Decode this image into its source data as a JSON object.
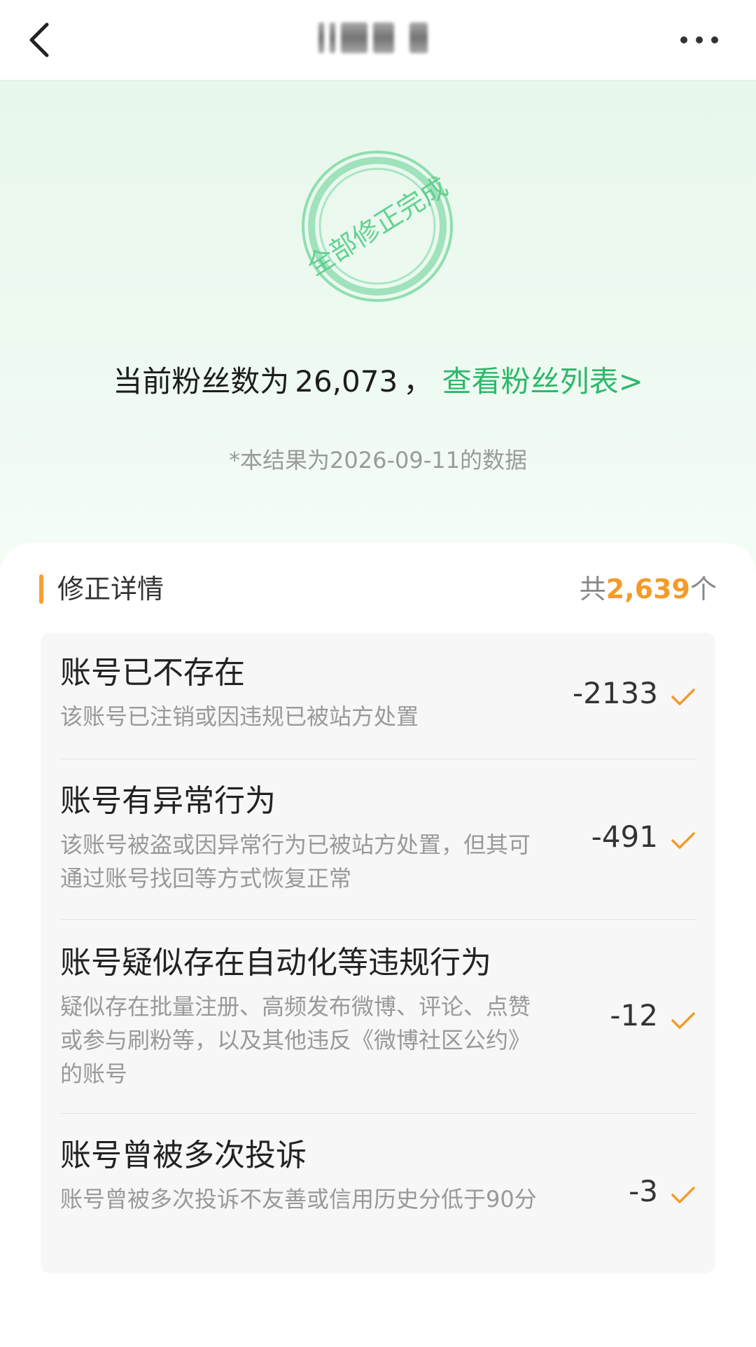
{
  "header": {
    "back_icon": "chevron-left-icon",
    "more_icon": "more-horizontal-icon"
  },
  "hero": {
    "stamp_text": "全部修正完成",
    "fans_prefix": "当前粉丝数为",
    "fans_count": "26,073",
    "fans_separator": "，",
    "fans_link": "查看粉丝列表>",
    "note": "*本结果为2026-09-11的数据"
  },
  "details": {
    "title": "修正详情",
    "total_prefix": "共",
    "total_count": "2,639",
    "total_suffix": "个",
    "items": [
      {
        "title": "账号已不存在",
        "desc": "该账号已注销或因违规已被站方处置",
        "value": "-2133"
      },
      {
        "title": "账号有异常行为",
        "desc": "该账号被盗或因异常行为已被站方处置，但其可通过账号找回等方式恢复正常",
        "value": "-491"
      },
      {
        "title": "账号疑似存在自动化等违规行为",
        "desc": "疑似存在批量注册、高频发布微博、评论、点赞或参与刷粉等，以及其他违反《微博社区公约》的账号",
        "value": "-12"
      },
      {
        "title": "账号曾被多次投诉",
        "desc": "账号曾被多次投诉不友善或信用历史分低于90分",
        "value": "-3"
      }
    ]
  },
  "colors": {
    "accent_green": "#2eb86b",
    "accent_orange": "#f39b2a"
  }
}
